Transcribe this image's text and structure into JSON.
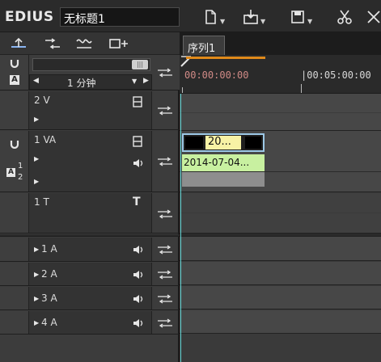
{
  "app": {
    "name": "EDIUS",
    "project_name": "无标题1"
  },
  "toolbar": {
    "icons": [
      "new-file-icon",
      "import-icon",
      "save-icon",
      "cut-icon",
      "delete-icon"
    ],
    "arrow": "▼"
  },
  "scale": {
    "value": "1 分钟",
    "left_arrow": "◀",
    "right_arrow": "▶",
    "down_arrow": "▼",
    "scroll_grip": "|||"
  },
  "sequence": {
    "tab_label": "序列1"
  },
  "ruler": {
    "timecodes": [
      "00:00:00:00",
      "|00:05:00:00"
    ]
  },
  "tracks": [
    {
      "id": "2V",
      "name": "2 V"
    },
    {
      "id": "1VA",
      "name": "1 VA",
      "sub": "1",
      "sub2": "2"
    },
    {
      "id": "1T",
      "name": "1 T",
      "t_icon": "T"
    },
    {
      "id": "1A",
      "name": "1 A"
    },
    {
      "id": "2A",
      "name": "2 A"
    },
    {
      "id": "3A",
      "name": "3 A"
    },
    {
      "id": "4A",
      "name": "4 A"
    }
  ],
  "clip": {
    "video_label": "20...",
    "audio_label": "2014-07-04..."
  },
  "glyphs": {
    "expand": "▶",
    "speaker": "🔊",
    "a_label": "A",
    "v_label": "V"
  },
  "colors": {
    "accent_cyan": "#5fd3d3",
    "clip_yellow": "#f7f2a5",
    "clip_green": "#c8f0a0",
    "timecode_red": "#d08a86",
    "orange_bar": "#e08a1a"
  }
}
